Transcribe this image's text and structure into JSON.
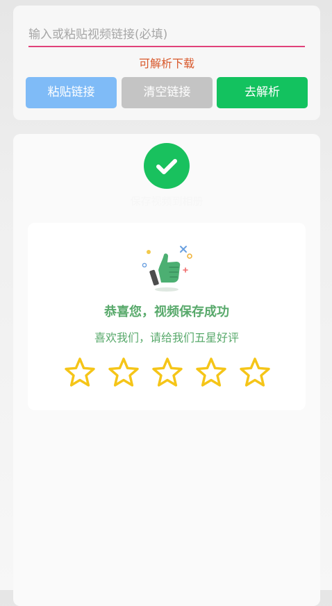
{
  "input": {
    "value": "",
    "placeholder": "输入或粘贴视频链接(必填)"
  },
  "hint": "可解析下载",
  "buttons": {
    "paste": "粘贴链接",
    "clear": "清空链接",
    "parse": "去解析"
  },
  "result": {
    "status_icon": "check-circle-icon",
    "status_text": "保存视频到相册",
    "praise_title": "恭喜您，视频保存成功",
    "praise_subtitle": "喜欢我们，请给我们五星好评",
    "rating": {
      "value": 0,
      "max": 5
    }
  },
  "colors": {
    "accent_green": "#19c15e",
    "paste_blue": "#7fbbf7",
    "clear_gray": "#c4c4c4",
    "hint_orange": "#d8572a",
    "underline_pink": "#e0417a",
    "star_yellow": "#f5c518",
    "praise_green": "#58a96b"
  }
}
